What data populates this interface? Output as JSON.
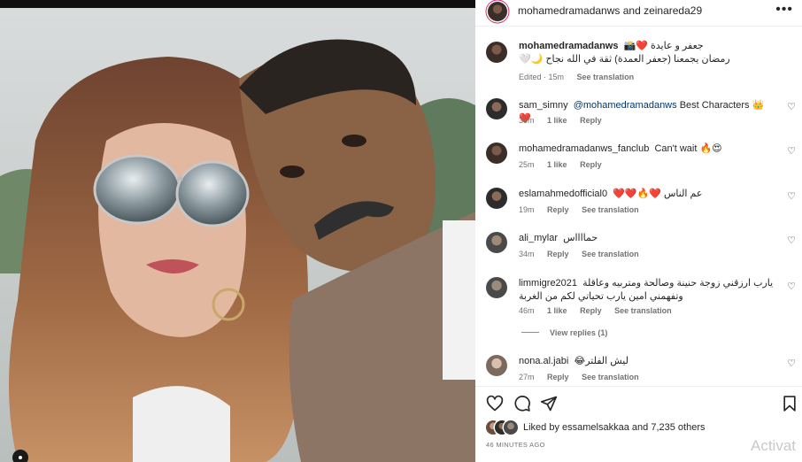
{
  "post": {
    "header_title": "mohamedramadanws and zeinareda29",
    "caption": {
      "username": "mohamedramadanws",
      "line1": "جعفر و عايدة ❤️📸",
      "line2": "رمضان يجمعنا (جعفر العمدة) ثقة في الله نجاح 🌙🤍",
      "edited": "Edited · 15m",
      "see_translation": "See translation"
    }
  },
  "comments": [
    {
      "username": "sam_simny",
      "mention": "@mohamedramadanws",
      "text": " Best Characters 👑 ❤️",
      "time": "39m",
      "likes": "1 like",
      "reply": "Reply",
      "translate": ""
    },
    {
      "username": "mohamedramadanws_fanclub",
      "mention": "",
      "text": "Can't wait 🔥😍",
      "time": "25m",
      "likes": "1 like",
      "reply": "Reply",
      "translate": ""
    },
    {
      "username": "eslamahmedofficial0",
      "mention": "",
      "text": "عم الناس ❤️🔥❤️❤️",
      "time": "19m",
      "likes": "",
      "reply": "Reply",
      "translate": "See translation"
    },
    {
      "username": "ali_mylar",
      "mention": "",
      "text": "حمااااس",
      "time": "34m",
      "likes": "",
      "reply": "Reply",
      "translate": "See translation"
    },
    {
      "username": "limmigre2021",
      "mention": "",
      "text": "يارب ارزقني زوجة حنينة وصالحة ومتربيه وعاقلة وتفهمني امين يارب تحياتي لكم من الغربة",
      "time": "46m",
      "likes": "1 like",
      "reply": "Reply",
      "translate": "See translation"
    },
    {
      "username": "nona.al.jabi",
      "mention": "",
      "text": "ليش الفلتر😂",
      "time": "27m",
      "likes": "",
      "reply": "Reply",
      "translate": "See translation"
    }
  ],
  "view_replies": "View replies (1)",
  "likes_line": {
    "prefix": "Liked by ",
    "user": "essamelsakkaa",
    "suffix": " and ",
    "others": "7,235 others"
  },
  "posted_ago": "46 MINUTES AGO",
  "watermark": "Activat",
  "icons": {
    "more": "more-horizontal-icon",
    "heart": "heart-outline-icon",
    "comment": "comment-bubble-icon",
    "share": "paper-plane-icon",
    "save": "bookmark-icon"
  },
  "colors": {
    "link_blue": "#00376b",
    "verified": "#0095f6",
    "meta_gray": "#737373"
  }
}
